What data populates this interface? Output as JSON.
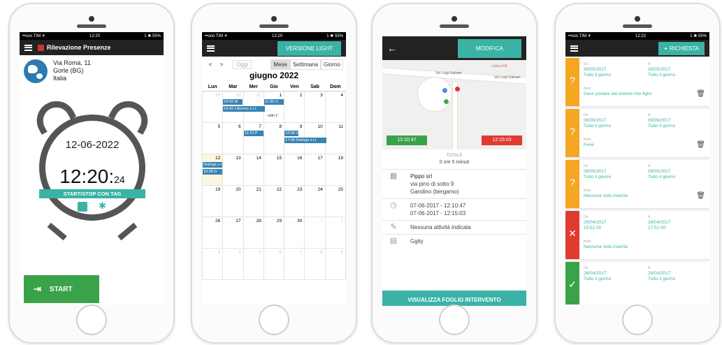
{
  "phone1": {
    "status": {
      "carrier": "••ooo TIM ✈",
      "time": "12:20",
      "battery": "1 ✱ 55%"
    },
    "title": "Rilevazione Presenze",
    "address": [
      "Via Roma, 11",
      "Gorle (BG)",
      "Italia"
    ],
    "date": "12-06-2022",
    "time_hm": "12:20",
    "time_s": "24",
    "tag_label": "START/STOP CON TAG",
    "start_label": "START"
  },
  "phone2": {
    "status": {
      "carrier": "••ooo TIM ✈",
      "time": "12:20",
      "battery": "1 ✱ 55%"
    },
    "light_btn": "VERSIONE LIGHT",
    "prev": "<",
    "next": ">",
    "today": "Oggi",
    "modes": [
      "Mese",
      "Settimana",
      "Giorno"
    ],
    "month": "giugno 2022",
    "days": [
      "Lun",
      "Mar",
      "Mer",
      "Gio",
      "Ven",
      "Sab",
      "Dom"
    ],
    "weeks": [
      [
        "29",
        "30",
        "31",
        "1",
        "2",
        "3",
        "4"
      ],
      [
        "5",
        "6",
        "7",
        "8",
        "9",
        "10",
        "11"
      ],
      [
        "12",
        "13",
        "14",
        "15",
        "16",
        "17",
        "18"
      ],
      [
        "19",
        "20",
        "21",
        "22",
        "23",
        "24",
        "25"
      ],
      [
        "26",
        "27",
        "28",
        "29",
        "30",
        "1",
        "2"
      ],
      [
        "3",
        "4",
        "5",
        "6",
        "7",
        "8",
        "9"
      ]
    ],
    "events": {
      "e1": "10:42 M",
      "e2": "10:42 Lillemex s.r.l.",
      "e3": "11:35 U",
      "more": "+altri 2",
      "e4": "12:10 P",
      "e5": "12:06 U",
      "e6": "17:06 Dialoga s.r.l.",
      "e7": "Dialoga s.r.l.",
      "e8": "10:08 D"
    }
  },
  "phone3": {
    "back": "←",
    "modify": "MODIFICA",
    "map_labels": {
      "r1": "Via Luigi Galvani",
      "r2": "Via Luigi Galvani",
      "r3": "Lisboa Kft"
    },
    "start_time": "12:10:47",
    "end_time": "12:15:03",
    "total_label": "TOTALE",
    "total_value": "0 ore 5 minuti",
    "client": {
      "name": "Pippo srl",
      "street": "via pino di sotto 9",
      "city": "Gandino (bergamo)"
    },
    "times": [
      "07-06-2017 - 12:10:47",
      "07-06-2017 - 12:15:03"
    ],
    "activity": "Nessuna attività indicata",
    "note": "Ggity",
    "button": "VISUALIZZA FOGLIO INTERVENTO"
  },
  "phone4": {
    "status": {
      "carrier": "••ooo TIM ✈",
      "time": "12:22",
      "battery": "1 ✱ 55%"
    },
    "request_btn": "RICHIESTA",
    "from_label": "Da",
    "to_label": "A",
    "note_label": "Note",
    "requests": [
      {
        "status": "?",
        "from_date": "30/05/2017",
        "from_time": "Tutto il giorno",
        "to_date": "30/05/2017",
        "to_time": "Tutto il giorno",
        "note": "Devo portare dal dottore mio figlio"
      },
      {
        "status": "?",
        "from_date": "08/06/2017",
        "from_time": "Tutto il giorno",
        "to_date": "09/06/2017",
        "to_time": "Tutto il giorno",
        "note": "Ferie"
      },
      {
        "status": "?",
        "from_date": "09/05/2017",
        "from_time": "Tutto il giorno",
        "to_date": "09/05/2017",
        "to_time": "Tutto il giorno",
        "note": "Nessuna nota inserita"
      },
      {
        "status": "✕",
        "from_date": "26/04/2017",
        "from_time": "15:51:00",
        "to_date": "28/04/2017",
        "to_time": "17:51:00",
        "note": "Nessuna nota inserita"
      },
      {
        "status": "✓",
        "from_date": "26/04/2017",
        "from_time": "Tutto il giorno",
        "to_date": "26/04/2017",
        "to_time": "Tutto il giorno",
        "note": ""
      }
    ]
  },
  "colors": {
    "teal": "#3ab3a6",
    "green": "#3aa34a",
    "orange": "#f5a623",
    "red": "#e03b2f",
    "event_blue": "#3783b6",
    "bar": "#222222"
  }
}
